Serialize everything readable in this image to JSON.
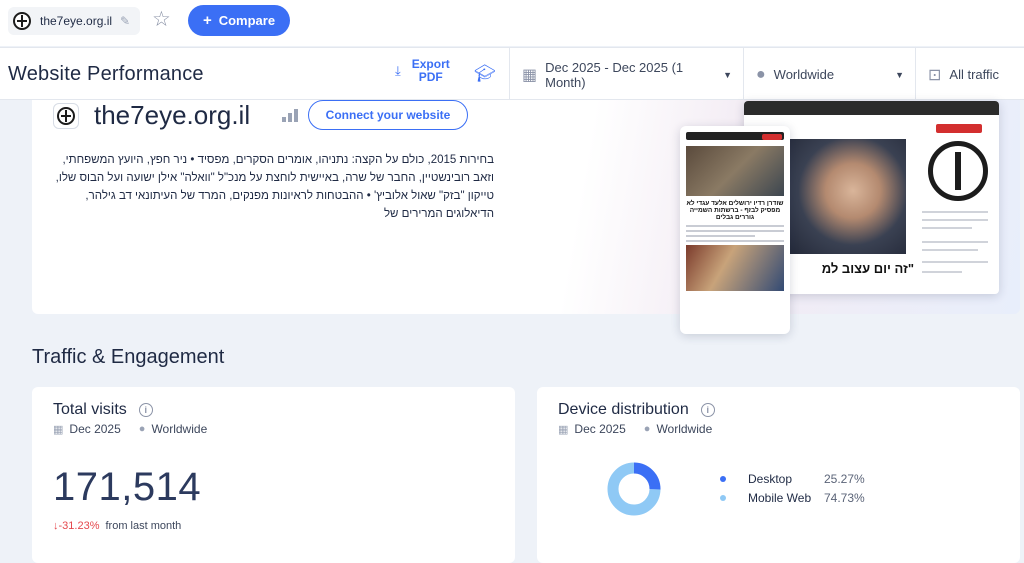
{
  "topbar": {
    "site_name": "the7eye.org.il",
    "compare_label": "Compare"
  },
  "header": {
    "title": "Website Performance",
    "export_label_line1": "Export",
    "export_label_line2": "PDF",
    "date_range": "Dec 2025 - Dec 2025 (1 Month)",
    "region": "Worldwide",
    "traffic": "All traffic"
  },
  "overview": {
    "domain": "the7eye.org.il",
    "connect_label": "Connect your website",
    "description": "בחירות 2015, כולם על הקצה: נתניהו, אומרים הסקרים, מפסיד • ניר חפץ, היועץ המשפחתי, וזאב רובינשטיין, החבר של שרה, באיישית לוחצת על מנכ\"ל \"וואלה\" אילן ישועה ועל הבוס שלו, טייקון \"בזק\" שאול אלוביץ' • ההבטחות לראיונות מפנקים, המרד של העיתונאי דב גילהר, הדיאלוגים המרירים של",
    "phone_headline": "שודרן רדיו ירושלים אלעד עגדי לא מפסיק לבזף - ברשתות השמייה גוררים גבלים",
    "desktop_headline": "\"זה יום עצוב למ"
  },
  "section": {
    "title": "Traffic & Engagement"
  },
  "total_visits": {
    "title": "Total visits",
    "date": "Dec 2025",
    "region": "Worldwide",
    "value": "171,514",
    "change": "↓-31.23%",
    "change_suffix": "from last month"
  },
  "device_distribution": {
    "title": "Device distribution",
    "date": "Dec 2025",
    "region": "Worldwide",
    "items": [
      {
        "name": "Desktop",
        "pct": "25.27%",
        "value": 25.27,
        "color": "#3b6ff5"
      },
      {
        "name": "Mobile Web",
        "pct": "74.73%",
        "value": 74.73,
        "color": "#8fc9f5"
      }
    ]
  }
}
